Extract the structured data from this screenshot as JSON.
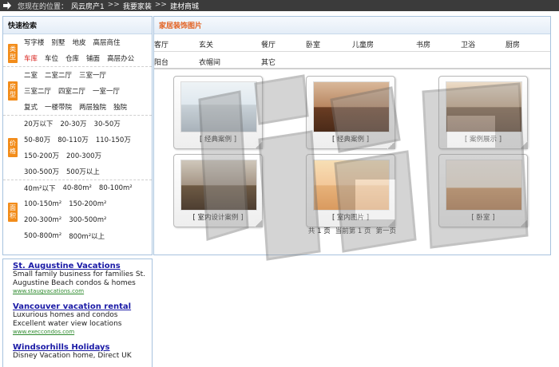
{
  "breadcrumb": {
    "prefix": "您现在的位置：",
    "items": [
      "风云房产1",
      ">>",
      "我要家装",
      ">>",
      "建材商城"
    ]
  },
  "left": {
    "title": "快速检索",
    "groups": [
      {
        "tag": "类型",
        "rows": [
          [
            "写字楼",
            "别墅",
            "地皮",
            "高层商住"
          ],
          [
            "车库",
            "车位",
            "仓库",
            "铺面",
            "高层办公"
          ]
        ]
      },
      {
        "tag": "房型",
        "rows": [
          [
            "二室",
            "二室二厅",
            "三室一厅"
          ],
          [
            "三室二厅",
            "四室二厅",
            "一室一厅"
          ],
          [
            "复式",
            "一楼带院",
            "两层独院",
            "独院"
          ]
        ]
      },
      {
        "tag": "价格",
        "rows": [
          [
            "20万以下",
            "20-30万",
            "30-50万"
          ],
          [
            "50-80万",
            "80-110万",
            "110-150万"
          ],
          [
            "150-200万",
            "200-300万"
          ],
          [
            "300-500万",
            "500万以上"
          ]
        ]
      },
      {
        "tag": "面积",
        "rows": [
          [
            "40m²以下",
            "40-80m²",
            "80-100m²"
          ],
          [
            "100-150m²",
            "150-200m²"
          ],
          [
            "200-300m²",
            "300-500m²"
          ],
          [
            "500-800m²",
            "800m²以上"
          ]
        ]
      }
    ],
    "active_item": "车库"
  },
  "ads": [
    {
      "title": "St. Augustine Vacations",
      "text": "Small family business for families St. Augustine Beach condos & homes",
      "url": "www.staugvacations.com"
    },
    {
      "title": "Vancouver vacation rental",
      "text": "Luxurious homes and condos Excellent water view locations",
      "url": "www.execcondos.com"
    },
    {
      "title": "Windsorhills Holidays",
      "text": "Disney Vacation home, Direct UK",
      "url": ""
    }
  ],
  "main": {
    "title": "家居装饰图片",
    "categories_row1": [
      "客厅",
      "玄关",
      "餐厅",
      "卧室",
      "儿童房",
      "书房",
      "卫浴",
      "厨房"
    ],
    "categories_row2": [
      "阳台",
      "衣帽间",
      "其它"
    ],
    "thumbnails": [
      {
        "caption": "[ 经典案例 ]"
      },
      {
        "caption": "[ 经典案例 ]"
      },
      {
        "caption": "[ 案例展示 ]"
      },
      {
        "caption": "[ 室内设计案例 ]"
      },
      {
        "caption": "[ 室内图片 ]"
      },
      {
        "caption": "[ 卧室 ]"
      }
    ],
    "pager": {
      "total": "共 1 页",
      "current": "当前第 1 页",
      "first": "第一页"
    }
  },
  "colors": {
    "accent": "#e2601f",
    "tag": "#f28c1a",
    "border": "#a8c3de",
    "topbar": "#3b3b3b"
  },
  "icons": {
    "breadcrumb": "arrow-right-icon"
  }
}
